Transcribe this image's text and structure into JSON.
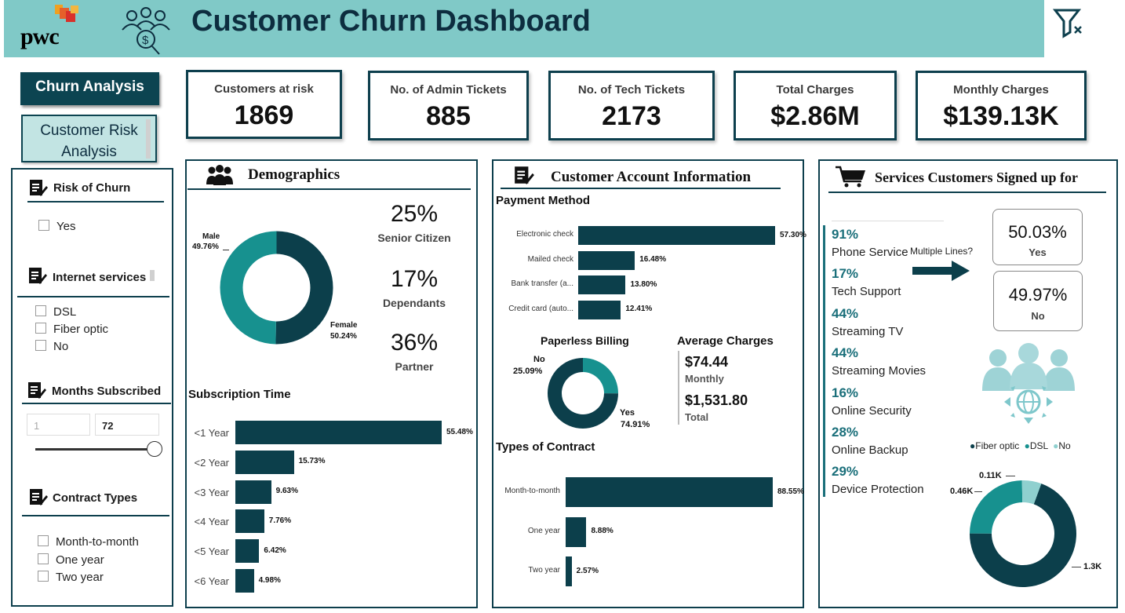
{
  "header": {
    "logo": "pwc",
    "title": "Customer Churn Dashboard"
  },
  "nav": {
    "churn_analysis": "Churn Analysis",
    "customer_risk": "Customer Risk Analysis"
  },
  "kpis": [
    {
      "label": "Customers at risk",
      "value": "1869"
    },
    {
      "label": "No. of Admin Tickets",
      "value": "885"
    },
    {
      "label": "No. of Tech Tickets",
      "value": "2173"
    },
    {
      "label": "Total Charges",
      "value": "$2.86M"
    },
    {
      "label": "Monthly Charges",
      "value": "$139.13K"
    }
  ],
  "slicers": {
    "risk": {
      "title": "Risk of Churn",
      "options": [
        "Yes"
      ]
    },
    "internet": {
      "title": "Internet services",
      "options": [
        "DSL",
        "Fiber optic",
        "No"
      ]
    },
    "months": {
      "title": "Months Subscribed",
      "min": "1",
      "max": "72"
    },
    "contract": {
      "title": "Contract Types",
      "options": [
        "Month-to-month",
        "One year",
        "Two year"
      ]
    }
  },
  "demographics": {
    "title": "Demographics",
    "gender_donut": {
      "male_label": "Male",
      "male_pct": "49.76%",
      "female_label": "Female",
      "female_pct": "50.24%",
      "male_value": 49.76,
      "female_value": 50.24
    },
    "stats": [
      {
        "value": "25%",
        "label": "Senior Citizen"
      },
      {
        "value": "17%",
        "label": "Dependants"
      },
      {
        "value": "36%",
        "label": "Partner"
      }
    ],
    "subscription_title": "Subscription Time"
  },
  "account": {
    "title": "Customer Account Information",
    "payment_title": "Payment Method",
    "paperless_title": "Paperless Billing",
    "paperless": {
      "no_label": "No",
      "no_pct": "25.09%",
      "yes_label": "Yes",
      "yes_pct": "74.91%",
      "no_value": 25.09,
      "yes_value": 74.91
    },
    "avg_title": "Average Charges",
    "avg_monthly": "$74.44",
    "avg_monthly_label": "Monthly",
    "avg_total": "$1,531.80",
    "avg_total_label": "Total",
    "contract_title": "Types of Contract"
  },
  "services": {
    "title": "Services Customers Signed up for",
    "list": [
      {
        "pct": "91%",
        "label": "Phone Service"
      },
      {
        "pct": "17%",
        "label": "Tech Support"
      },
      {
        "pct": "44%",
        "label": "Streaming TV"
      },
      {
        "pct": "44%",
        "label": "Streaming Movies"
      },
      {
        "pct": "16%",
        "label": "Online Security"
      },
      {
        "pct": "28%",
        "label": "Online Backup"
      },
      {
        "pct": "29%",
        "label": "Device Protection"
      }
    ],
    "multiple_lines": "Multiple Lines?",
    "yes_pct": "50.03%",
    "yes_label": "Yes",
    "no_pct": "49.97%",
    "no_label": "No",
    "legend": [
      "Fiber optic",
      "DSL",
      "No"
    ],
    "donut_labels": {
      "no": "0.11K",
      "dsl": "0.46K",
      "fiber": "1.3K"
    }
  },
  "colors": {
    "dark": "#0c3f4b",
    "teal": "#17918f",
    "light": "#8fd0cf",
    "header": "#80c9c7"
  },
  "chart_data": [
    {
      "type": "bar",
      "title": "Subscription Time",
      "categories": [
        "<1 Year",
        "<2 Year",
        "<3 Year",
        "<4 Year",
        "<5 Year",
        "<6 Year"
      ],
      "values": [
        55.48,
        15.73,
        9.63,
        7.76,
        6.42,
        4.98
      ],
      "labels": [
        "55.48%",
        "15.73%",
        "9.63%",
        "7.76%",
        "6.42%",
        "4.98%"
      ]
    },
    {
      "type": "bar",
      "title": "Payment Method",
      "categories": [
        "Electronic check",
        "Mailed check",
        "Bank transfer (a...",
        "Credit card (auto..."
      ],
      "values": [
        57.3,
        16.48,
        13.8,
        12.41
      ],
      "labels": [
        "57.30%",
        "16.48%",
        "13.80%",
        "12.41%"
      ]
    },
    {
      "type": "bar",
      "title": "Types of Contract",
      "categories": [
        "Month-to-month",
        "One year",
        "Two year"
      ],
      "values": [
        88.55,
        8.88,
        2.57
      ],
      "labels": [
        "88.55%",
        "8.88%",
        "2.57%"
      ]
    },
    {
      "type": "pie",
      "title": "",
      "categories": [
        "Fiber optic",
        "DSL",
        "No"
      ],
      "values": [
        1.3,
        0.46,
        0.11
      ],
      "labels": [
        "1.3K",
        "0.46K",
        "0.11K"
      ]
    }
  ]
}
